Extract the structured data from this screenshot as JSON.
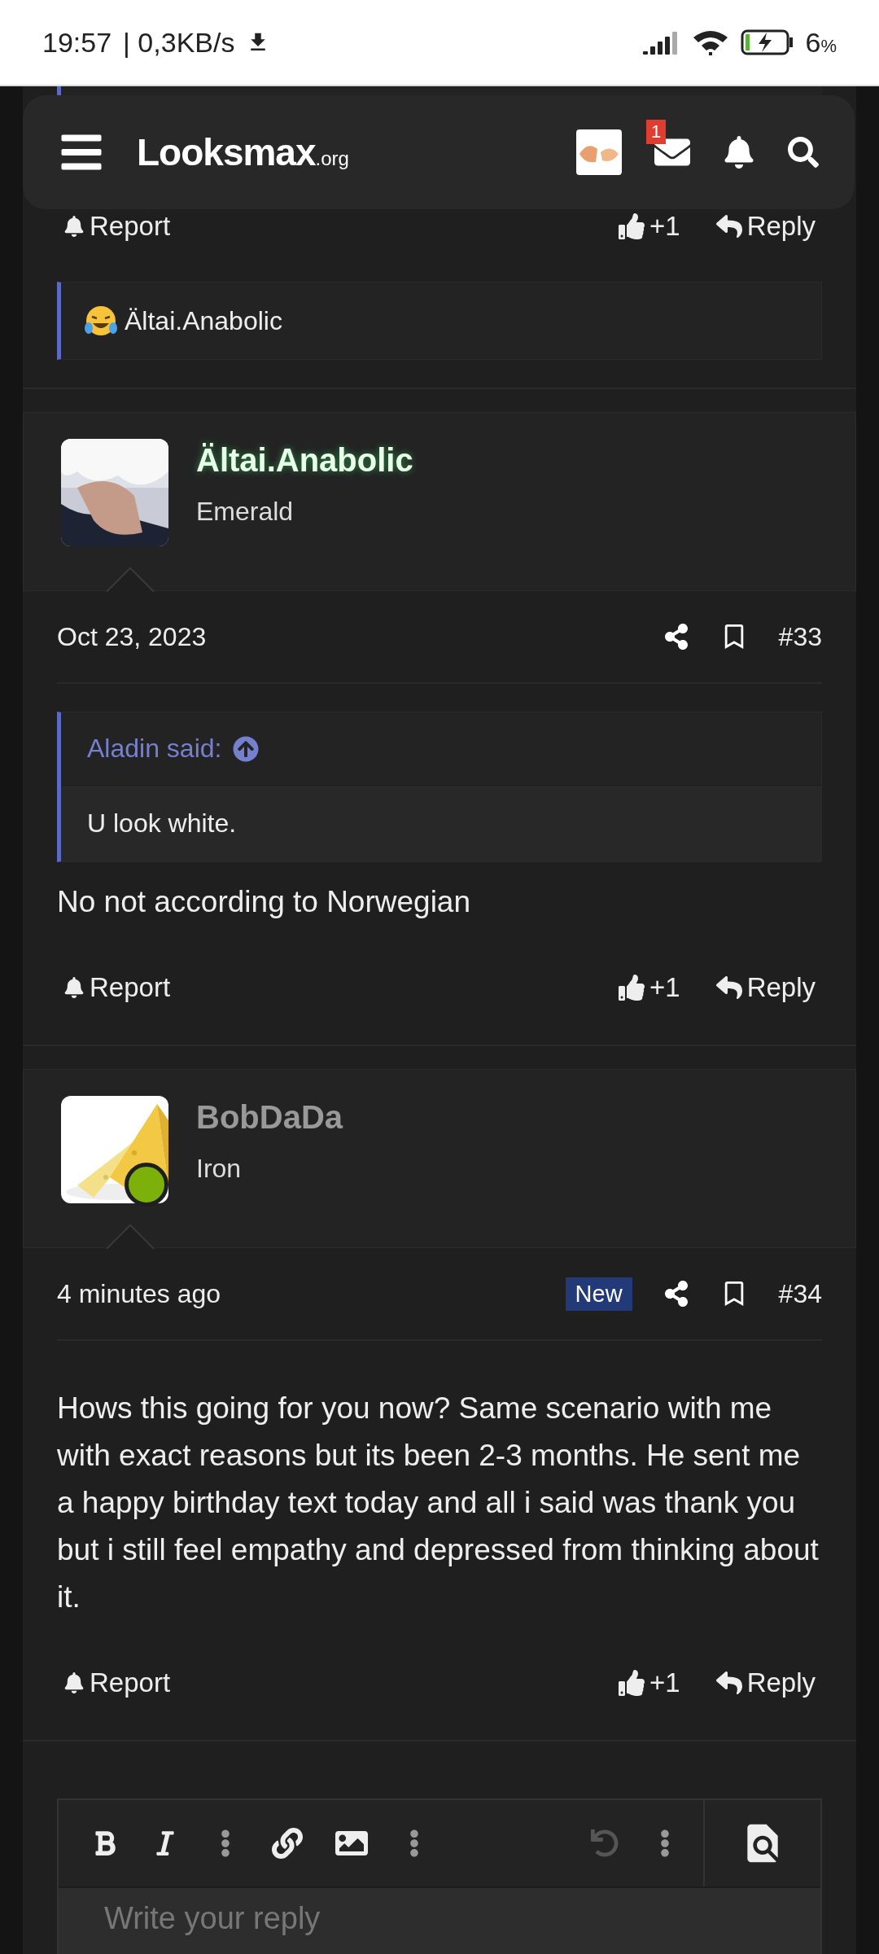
{
  "status_bar": {
    "time": "19:57",
    "speed": "| 0,3KB/s",
    "battery": "6",
    "battery_unit": "%"
  },
  "header": {
    "logo": "Looksmax",
    "logo_suffix": ".org",
    "message_badge": "1"
  },
  "previous_post": {
    "actions": {
      "report": "Report",
      "like": "+1",
      "reply": "Reply"
    },
    "reaction_user": "Ältai.Anabolic"
  },
  "posts": [
    {
      "username": "Ältai.Anabolic",
      "highlighted": true,
      "rank": "Emerald",
      "online": false,
      "date": "Oct 23, 2023",
      "new": false,
      "number": "#33",
      "quote": {
        "author": "Aladin said:",
        "text": "U look white."
      },
      "message": "No not according to Norwegian",
      "actions": {
        "report": "Report",
        "like": "+1",
        "reply": "Reply"
      }
    },
    {
      "username": "BobDaDa",
      "highlighted": false,
      "rank": "Iron",
      "online": true,
      "date": "4 minutes ago",
      "new": true,
      "new_label": "New",
      "number": "#34",
      "message": "Hows this going for you now? Same scenario with me with exact reasons but its been 2-3 months. He sent me a happy birthday text today and all i said was thank you but i still feel empathy and depressed from thinking about it.",
      "actions": {
        "report": "Report",
        "like": "+1",
        "reply": "Reply"
      }
    }
  ],
  "editor": {
    "placeholder": "Write your reply"
  }
}
